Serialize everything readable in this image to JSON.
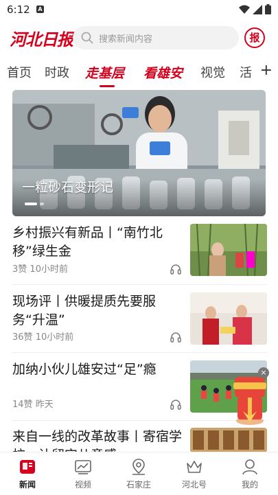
{
  "status_bar": {
    "time": "6:12",
    "notification_letter": "A"
  },
  "header": {
    "logo_text": "河北日报",
    "search_placeholder": "搜索新闻内容",
    "newspaper_label": "报"
  },
  "tabs": [
    {
      "label": "首页",
      "special": false
    },
    {
      "label": "时政",
      "special": false
    },
    {
      "label": "走基层",
      "special": true,
      "active": true
    },
    {
      "label": "看雄安",
      "special": true
    },
    {
      "label": "视觉",
      "special": false
    },
    {
      "label": "活",
      "special": false
    }
  ],
  "banner": {
    "title": "一粒砂石变形记"
  },
  "news": [
    {
      "title": "乡村振兴有新品丨“南竹北移”绿生金",
      "likes": "3赞",
      "time": "10小时前"
    },
    {
      "title": "现场评丨供暖提质先要服务“升温”",
      "likes": "36赞",
      "time": "10小时前"
    },
    {
      "title": "加纳小伙儿雄安过“足”瘾",
      "likes": "14赞",
      "time": "昨天"
    },
    {
      "title": "来自一线的改革故事丨寄宿学校，让留守儿童感",
      "likes": "",
      "time": ""
    }
  ],
  "bottom_nav": [
    {
      "label": "新闻",
      "icon": "news-icon",
      "active": true
    },
    {
      "label": "视频",
      "icon": "video-icon"
    },
    {
      "label": "石家庄",
      "icon": "location-icon"
    },
    {
      "label": "河北号",
      "icon": "crown-icon"
    },
    {
      "label": "我的",
      "icon": "profile-icon"
    }
  ],
  "colors": {
    "accent": "#d7001c"
  }
}
